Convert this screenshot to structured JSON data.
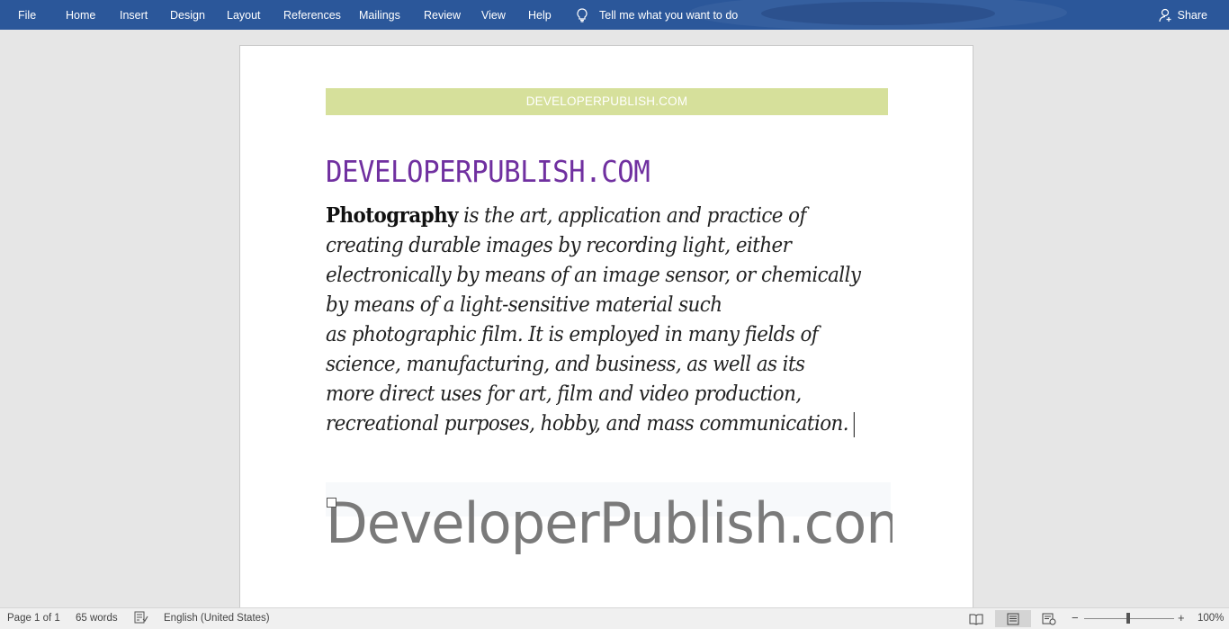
{
  "ribbon": {
    "tabs": [
      "File",
      "Home",
      "Insert",
      "Design",
      "Layout",
      "References",
      "Mailings",
      "Review",
      "View",
      "Help"
    ],
    "tell_me": "Tell me what you want to do",
    "share": "Share"
  },
  "document": {
    "header_banner": "DEVELOPERPUBLISH.COM",
    "title": "DEVELOPERPUBLISH.COM",
    "bold_word": "Photography",
    "body_lines": [
      " is the art, application and practice of",
      "creating durable images by recording light, either",
      "electronically by means of an image sensor, or chemically",
      "by means of a light-sensitive material such",
      "as photographic film. It is employed in many fields of",
      "science, manufacturing, and business, as well as its",
      "more direct uses for art, film and video production,",
      "recreational purposes, hobby, and mass communication."
    ],
    "footer_text": "DeveloperPublish.com"
  },
  "status_bar": {
    "page": "Page 1 of 1",
    "words": "65 words",
    "language": "English (United States)",
    "zoom": "100%",
    "zoom_minus": "−",
    "zoom_plus": "+"
  },
  "colors": {
    "ribbon": "#2b579a",
    "banner": "#d6e09b",
    "title": "#7030a0",
    "watermark": "#7a7a7a"
  }
}
